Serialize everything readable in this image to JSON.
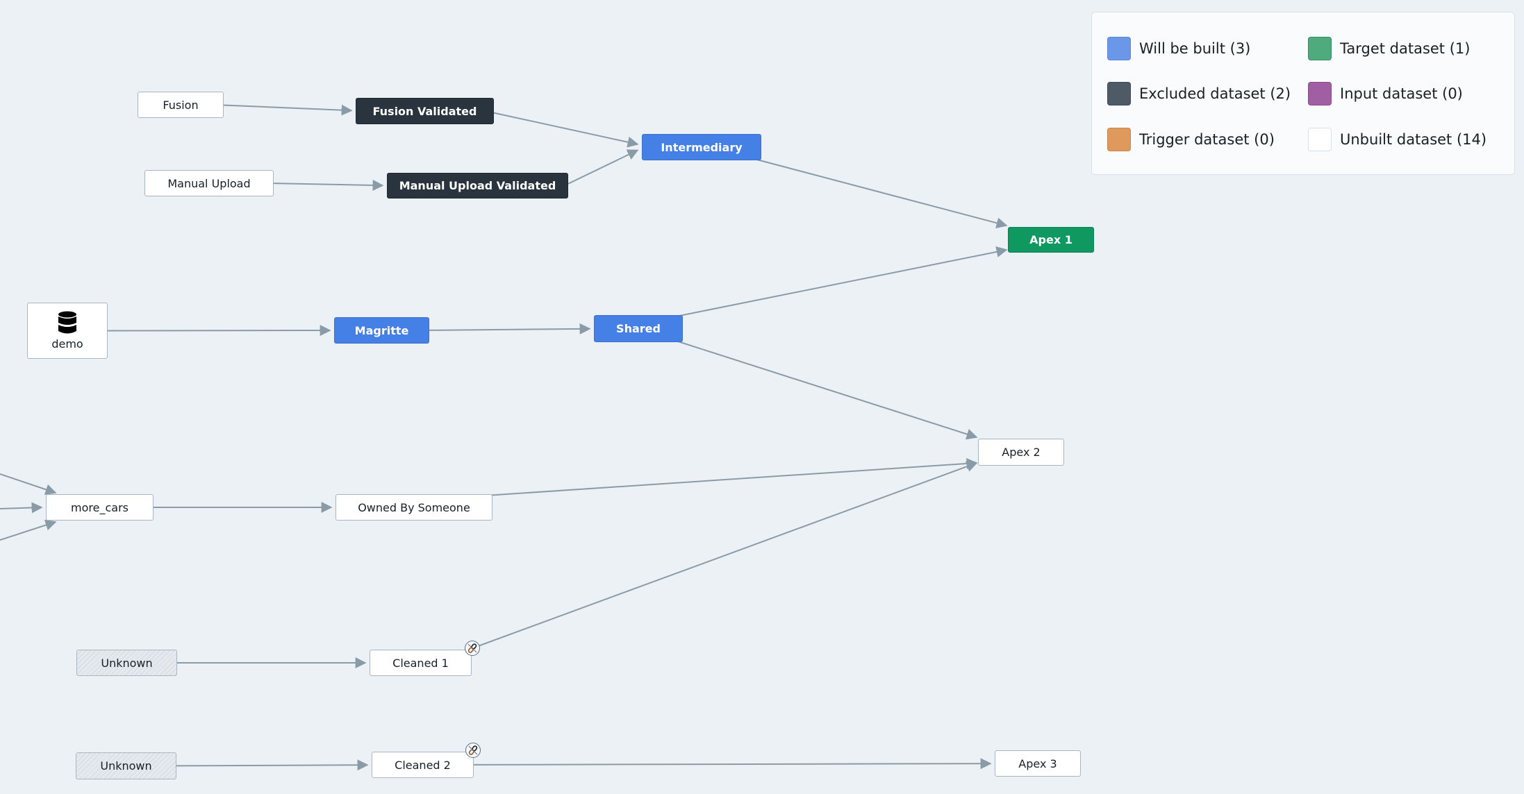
{
  "legend": {
    "items": [
      {
        "label": "Will be built (3)",
        "color": "#6a97e8",
        "border": "#5a87d8"
      },
      {
        "label": "Excluded dataset (2)",
        "color": "#4e5b66",
        "border": "#3e4a55"
      },
      {
        "label": "Trigger dataset (0)",
        "color": "#e0995c",
        "border": "#c8844a"
      },
      {
        "label": "Target dataset (1)",
        "color": "#4fab7e",
        "border": "#2e9060"
      },
      {
        "label": "Input dataset (0)",
        "color": "#a05ea3",
        "border": "#8a4a8d"
      },
      {
        "label": "Unbuilt dataset (14)",
        "color": "#ffffff",
        "border": "#d8e1e8"
      }
    ]
  },
  "nodes": [
    {
      "id": "fusion",
      "label": "Fusion",
      "status": "unbuilt"
    },
    {
      "id": "fusion_validated",
      "label": "Fusion Validated",
      "status": "excluded"
    },
    {
      "id": "manual_upload",
      "label": "Manual Upload",
      "status": "unbuilt"
    },
    {
      "id": "manual_upload_validated",
      "label": "Manual Upload Validated",
      "status": "excluded"
    },
    {
      "id": "intermediary",
      "label": "Intermediary",
      "status": "build"
    },
    {
      "id": "apex1",
      "label": "Apex 1",
      "status": "target"
    },
    {
      "id": "demo",
      "label": "demo",
      "status": "unbuilt",
      "icon": "database-icon"
    },
    {
      "id": "magritte",
      "label": "Magritte",
      "status": "build"
    },
    {
      "id": "shared",
      "label": "Shared",
      "status": "build"
    },
    {
      "id": "apex2",
      "label": "Apex 2",
      "status": "unbuilt"
    },
    {
      "id": "more_cars",
      "label": "more_cars",
      "status": "unbuilt"
    },
    {
      "id": "owned",
      "label": "Owned By Someone",
      "status": "unbuilt"
    },
    {
      "id": "unknown1",
      "label": "Unknown",
      "status": "unknown"
    },
    {
      "id": "cleaned1",
      "label": "Cleaned 1",
      "status": "unbuilt",
      "badge": "broken-link-icon"
    },
    {
      "id": "unknown2",
      "label": "Unknown",
      "status": "unknown"
    },
    {
      "id": "cleaned2",
      "label": "Cleaned 2",
      "status": "unbuilt",
      "badge": "broken-link-icon"
    },
    {
      "id": "apex3",
      "label": "Apex 3",
      "status": "unbuilt"
    }
  ],
  "edges": [
    {
      "from": "fusion",
      "to": "fusion_validated"
    },
    {
      "from": "manual_upload",
      "to": "manual_upload_validated"
    },
    {
      "from": "fusion_validated",
      "to": "intermediary"
    },
    {
      "from": "manual_upload_validated",
      "to": "intermediary"
    },
    {
      "from": "intermediary",
      "to": "apex1"
    },
    {
      "from": "demo",
      "to": "magritte"
    },
    {
      "from": "magritte",
      "to": "shared"
    },
    {
      "from": "shared",
      "to": "apex1"
    },
    {
      "from": "shared",
      "to": "apex2"
    },
    {
      "from": "owned",
      "to": "apex2"
    },
    {
      "from": "cleaned1",
      "to": "apex2"
    },
    {
      "from": "more_cars",
      "to": "owned"
    },
    {
      "from": "unknown1",
      "to": "cleaned1"
    },
    {
      "from": "unknown2",
      "to": "cleaned2"
    },
    {
      "from": "cleaned2",
      "to": "apex3"
    },
    {
      "from": "offscreen-1",
      "to": "more_cars"
    },
    {
      "from": "offscreen-2",
      "to": "more_cars"
    },
    {
      "from": "offscreen-3",
      "to": "more_cars"
    }
  ]
}
